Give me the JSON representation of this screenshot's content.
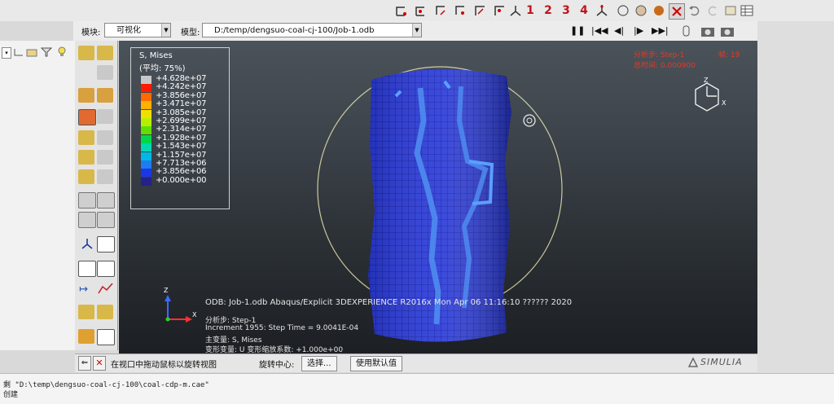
{
  "toolbar": {
    "view_numbers": [
      "1",
      "2",
      "3",
      "4"
    ]
  },
  "context": {
    "module_label": "模块:",
    "module_value": "可视化",
    "model_label": "模型:",
    "model_value": "D:/temp/dengsuo-coal-cj-100/Job-1.odb"
  },
  "legend": {
    "title": "S, Mises",
    "subtitle": "(平均: 75%)",
    "values": [
      "+4.628e+07",
      "+4.242e+07",
      "+3.856e+07",
      "+3.471e+07",
      "+3.085e+07",
      "+2.699e+07",
      "+2.314e+07",
      "+1.928e+07",
      "+1.543e+07",
      "+1.157e+07",
      "+7.713e+06",
      "+3.856e+06",
      "+0.000e+00"
    ],
    "colors": [
      "#c8c8c8",
      "#ff1a00",
      "#ff6a00",
      "#ffb000",
      "#f0e000",
      "#b6f000",
      "#5ee000",
      "#00d84a",
      "#00d8b0",
      "#00b8e8",
      "#1e7cf0",
      "#1a36e8",
      "#222288"
    ]
  },
  "step_info": {
    "step_line": "分析步: Step-1",
    "frame_label": "帧: 19",
    "time_line": "总时间: 0.000900"
  },
  "triad": {
    "z": "Z",
    "x": "X"
  },
  "odb_info": {
    "line1": "ODB: Job-1.odb    Abaqus/Explicit 3DEXPERIENCE R2016x    Mon Apr 06 11:16:10 ?????? 2020",
    "line2": "分析步: Step-1",
    "line3": "Increment      1955: Step Time =    9.0041E-04",
    "line4": "主变量: S, Mises",
    "line5": "变形变量: U   变形缩放系数: +1.000e+00"
  },
  "prompt": {
    "text": "在视口中拖动鼠标以旋转视图",
    "center_label": "旋转中心:",
    "select_btn": "选择...",
    "default_btn": "使用默认值"
  },
  "brand": "SIMULIA",
  "messages": {
    "line1": "剩 \"D:\\temp\\dengsuo-coal-cj-100\\coal-cdp-m.cae\"",
    "line2": "创建"
  }
}
